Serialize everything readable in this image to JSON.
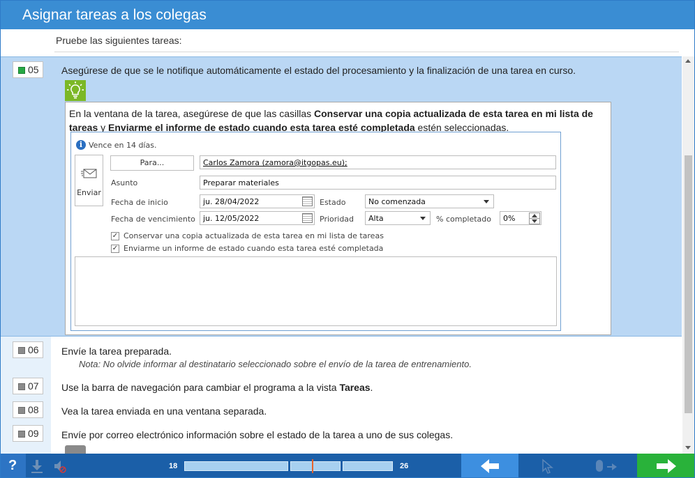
{
  "window": {
    "title": "Asignar tareas a los colegas"
  },
  "intro": "Pruebe las siguientes tareas:",
  "tasks": [
    {
      "number": "05",
      "status": "active",
      "text": "Asegúrese de que se le notifique automáticamente el estado del procesamiento y la finalización de una tarea en curso."
    },
    {
      "number": "06",
      "status": "pending",
      "text": "Envíe la tarea preparada.",
      "note": "Nota: No olvide informar al destinatario seleccionado sobre el envío de la tarea de entrenamiento."
    },
    {
      "number": "07",
      "status": "pending",
      "text_before": "Use la barra de navegación para cambiar el programa a la vista ",
      "text_bold": "Tareas",
      "text_after": "."
    },
    {
      "number": "08",
      "status": "pending",
      "text": "Vea la tarea enviada en una ventana separada."
    },
    {
      "number": "09",
      "status": "pending",
      "text": "Envíe por correo electrónico información sobre el estado de la tarea a uno de sus colegas."
    }
  ],
  "hint": {
    "icon": "lightbulb-icon",
    "part1": "En la ventana de la tarea, asegúrese de que las casillas ",
    "bold1": "Conservar una copia actualizada de esta tarea en mi lista de tareas",
    "part2": " y ",
    "bold2": "Enviarme el informe de estado cuando esta tarea esté completada",
    "part3": " estén seleccionadas."
  },
  "outlook": {
    "due_info": "Vence en 14 días.",
    "send_label": "Enviar",
    "to_button": "Para...",
    "to_value": "Carlos Zamora (zamora@itgopas.eu);",
    "subject_label": "Asunto",
    "subject_value": "Preparar materiales",
    "start_label": "Fecha de inicio",
    "start_value": "ju. 28/04/2022",
    "due_label": "Fecha de vencimiento",
    "due_value": "ju. 12/05/2022",
    "status_label": "Estado",
    "status_value": "No comenzada",
    "priority_label": "Prioridad",
    "priority_value": "Alta",
    "percent_label": "% completado",
    "percent_value": "0%",
    "checkbox1": "Conservar una copia actualizada de esta tarea en mi lista de tareas",
    "checkbox2": "Enviarme un informe de estado cuando esta tarea esté completada",
    "checkbox1_checked": true,
    "checkbox2_checked": true
  },
  "bottom": {
    "help": "?",
    "progress_start": "18",
    "progress_end": "26"
  }
}
